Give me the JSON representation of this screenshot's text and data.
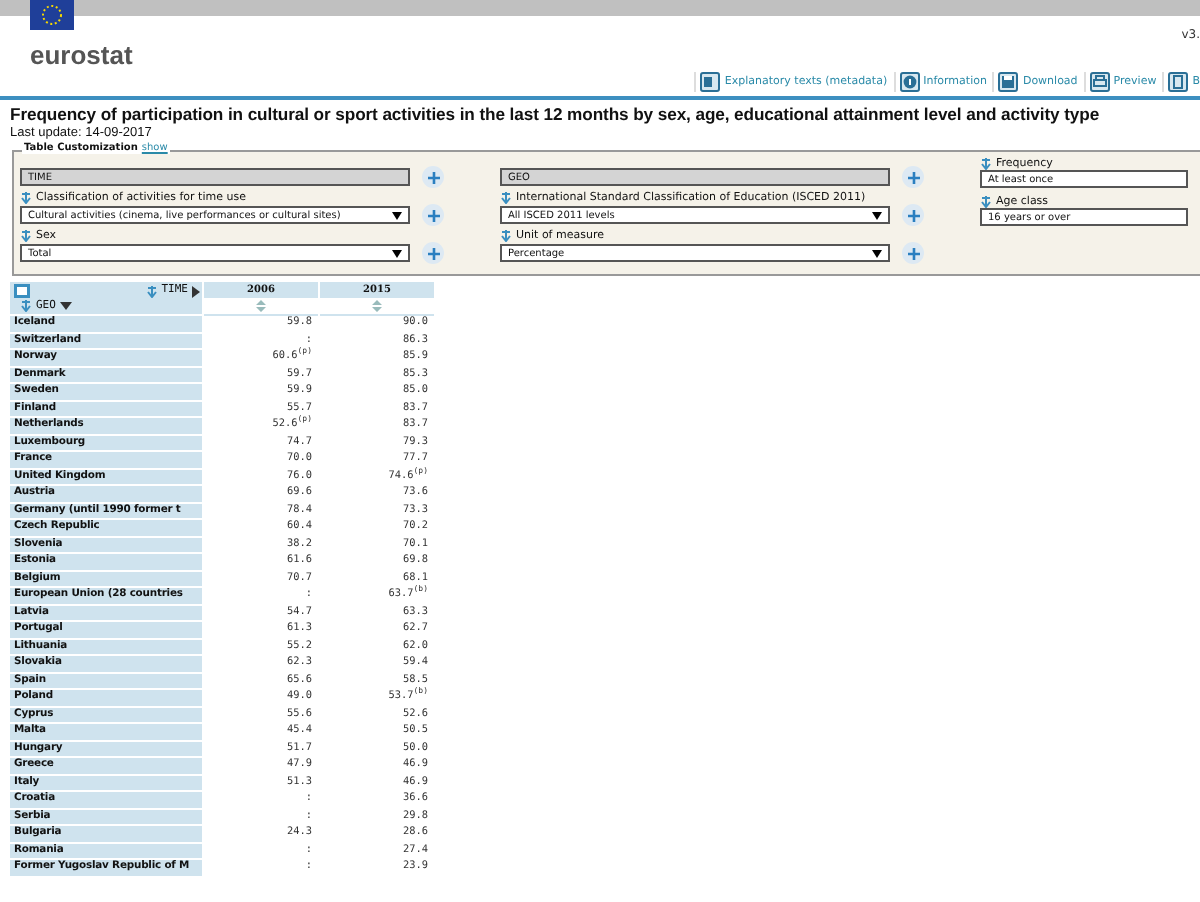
{
  "header": {
    "logo": "eurostat",
    "version": "v3.",
    "toolbar": [
      "Explanatory texts (metadata)",
      "Information",
      "Download",
      "Preview",
      "B"
    ]
  },
  "title": "Frequency of participation in cultural or sport activities in the last 12 months by sex, age, educational attainment level and activity type",
  "last_update": "Last update: 14-09-2017",
  "customization": {
    "legend": "Table Customization",
    "toggle": "show",
    "fields": [
      {
        "kind": "axis",
        "value": "TIME"
      },
      {
        "kind": "axis",
        "value": "GEO"
      },
      {
        "kind": "fixed",
        "label": "Frequency",
        "value": "At least once"
      },
      {
        "kind": "select",
        "label": "Classification of activities for time use",
        "value": "Cultural activities (cinema, live performances or cultural sites)"
      },
      {
        "kind": "select",
        "label": "International Standard Classification of Education (ISCED 2011)",
        "value": "All ISCED 2011 levels"
      },
      {
        "kind": "fixed",
        "label": "Age class",
        "value": "16 years or over"
      },
      {
        "kind": "select",
        "label": "Sex",
        "value": "Total"
      },
      {
        "kind": "select",
        "label": "Unit of measure",
        "value": "Percentage"
      }
    ]
  },
  "table": {
    "time_label": "TIME",
    "geo_label": "GEO",
    "columns": [
      "2006",
      "2015"
    ],
    "rows": [
      [
        "Iceland",
        "59.8",
        "90.0"
      ],
      [
        "Switzerland",
        ":",
        "86.3"
      ],
      [
        "Norway",
        "60.6$^{(p)}$",
        "85.9"
      ],
      [
        "Denmark",
        "59.7",
        "85.3"
      ],
      [
        "Sweden",
        "59.9",
        "85.0"
      ],
      [
        "Finland",
        "55.7",
        "83.7"
      ],
      [
        "Netherlands",
        "52.6$^{(p)}$",
        "83.7"
      ],
      [
        "Luxembourg",
        "74.7",
        "79.3"
      ],
      [
        "France",
        "70.0",
        "77.7"
      ],
      [
        "United Kingdom",
        "76.0",
        "74.6$^{(p)}$"
      ],
      [
        "Austria",
        "69.6",
        "73.6"
      ],
      [
        "Germany (until 1990 former t",
        "78.4",
        "73.3"
      ],
      [
        "Czech Republic",
        "60.4",
        "70.2"
      ],
      [
        "Slovenia",
        "38.2",
        "70.1"
      ],
      [
        "Estonia",
        "61.6",
        "69.8"
      ],
      [
        "Belgium",
        "70.7",
        "68.1"
      ],
      [
        "European Union (28 countries",
        ":",
        "63.7$^{(b)}$"
      ],
      [
        "Latvia",
        "54.7",
        "63.3"
      ],
      [
        "Portugal",
        "61.3",
        "62.7"
      ],
      [
        "Lithuania",
        "55.2",
        "62.0"
      ],
      [
        "Slovakia",
        "62.3",
        "59.4"
      ],
      [
        "Spain",
        "65.6",
        "58.5"
      ],
      [
        "Poland",
        "49.0",
        "53.7$^{(b)}$"
      ],
      [
        "Cyprus",
        "55.6",
        "52.6"
      ],
      [
        "Malta",
        "45.4",
        "50.5"
      ],
      [
        "Hungary",
        "51.7",
        "50.0"
      ],
      [
        "Greece",
        "47.9",
        "46.9"
      ],
      [
        "Italy",
        "51.3",
        "46.9"
      ],
      [
        "Croatia",
        ":",
        "36.6"
      ],
      [
        "Serbia",
        ":",
        "29.8"
      ],
      [
        "Bulgaria",
        "24.3",
        "28.6"
      ],
      [
        "Romania",
        ":",
        "27.4"
      ],
      [
        "Former Yugoslav Republic of M",
        ":",
        "23.9"
      ]
    ]
  }
}
